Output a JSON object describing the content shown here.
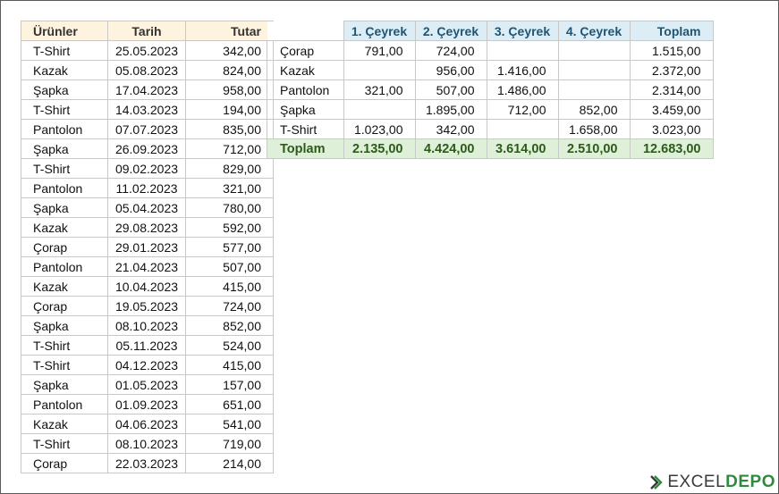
{
  "source_table": {
    "headers": [
      "Ürünler",
      "Tarih",
      "Tutar"
    ],
    "rows": [
      [
        "T-Shirt",
        "25.05.2023",
        "342,00"
      ],
      [
        "Kazak",
        "05.08.2023",
        "824,00"
      ],
      [
        "Şapka",
        "17.04.2023",
        "958,00"
      ],
      [
        "T-Shirt",
        "14.03.2023",
        "194,00"
      ],
      [
        "Pantolon",
        "07.07.2023",
        "835,00"
      ],
      [
        "Şapka",
        "26.09.2023",
        "712,00"
      ],
      [
        "T-Shirt",
        "09.02.2023",
        "829,00"
      ],
      [
        "Pantolon",
        "11.02.2023",
        "321,00"
      ],
      [
        "Şapka",
        "05.04.2023",
        "780,00"
      ],
      [
        "Kazak",
        "29.08.2023",
        "592,00"
      ],
      [
        "Çorap",
        "29.01.2023",
        "577,00"
      ],
      [
        "Pantolon",
        "21.04.2023",
        "507,00"
      ],
      [
        "Kazak",
        "10.04.2023",
        "415,00"
      ],
      [
        "Çorap",
        "19.05.2023",
        "724,00"
      ],
      [
        "Şapka",
        "08.10.2023",
        "852,00"
      ],
      [
        "T-Shirt",
        "05.11.2023",
        "524,00"
      ],
      [
        "T-Shirt",
        "04.12.2023",
        "415,00"
      ],
      [
        "Şapka",
        "01.05.2023",
        "157,00"
      ],
      [
        "Pantolon",
        "01.09.2023",
        "651,00"
      ],
      [
        "Kazak",
        "04.06.2023",
        "541,00"
      ],
      [
        "T-Shirt",
        "08.10.2023",
        "719,00"
      ],
      [
        "Çorap",
        "22.03.2023",
        "214,00"
      ]
    ]
  },
  "pivot_table": {
    "headers": [
      "1. Çeyrek",
      "2. Çeyrek",
      "3. Çeyrek",
      "4. Çeyrek",
      "Toplam"
    ],
    "rows": [
      [
        "Çorap",
        "791,00",
        "724,00",
        "",
        "",
        "1.515,00"
      ],
      [
        "Kazak",
        "",
        "956,00",
        "1.416,00",
        "",
        "2.372,00"
      ],
      [
        "Pantolon",
        "321,00",
        "507,00",
        "1.486,00",
        "",
        "2.314,00"
      ],
      [
        "Şapka",
        "",
        "1.895,00",
        "712,00",
        "852,00",
        "3.459,00"
      ],
      [
        "T-Shirt",
        "1.023,00",
        "342,00",
        "",
        "1.658,00",
        "3.023,00"
      ]
    ],
    "total_row": [
      "Toplam",
      "2.135,00",
      "4.424,00",
      "3.614,00",
      "2.510,00",
      "12.683,00"
    ]
  },
  "logo": {
    "part1": "EXCEL",
    "part2": "DEPO"
  },
  "colors": {
    "source_header_bg": "#fdf3de",
    "pivot_header_bg": "#dcedf6",
    "pivot_header_text": "#1f5473",
    "total_row_bg": "#dff0d8",
    "total_row_text": "#2d5a1b",
    "logo_green": "#2e8b3e"
  }
}
